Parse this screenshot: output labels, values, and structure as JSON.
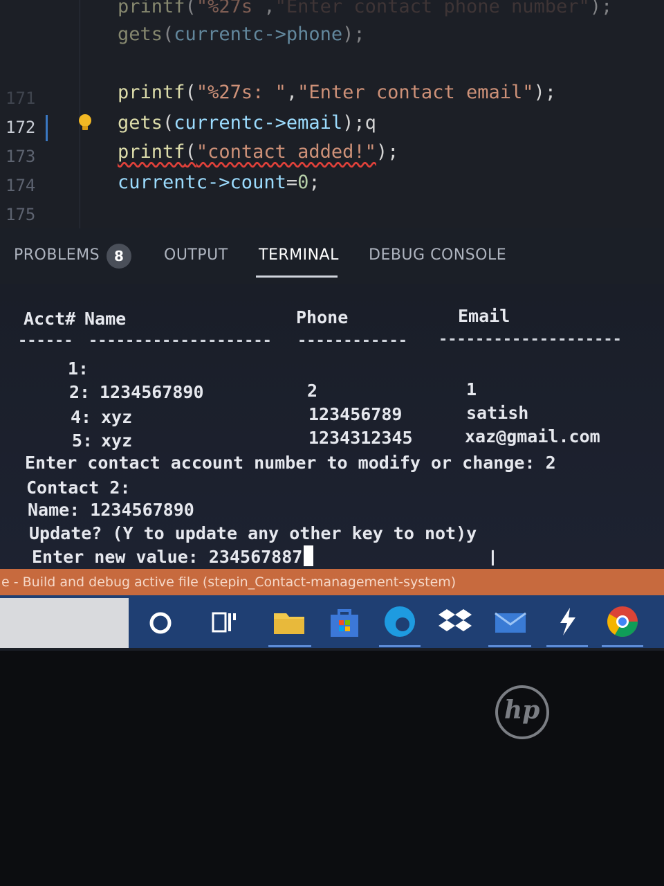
{
  "editor": {
    "line_numbers": [
      "171",
      "172",
      "173",
      "174",
      "175"
    ],
    "lines": [
      {
        "fn": "printf",
        "a": "(",
        "s1": "\"%27s",
        "b": " ,",
        "s2": "\"Enter contact phone number\"",
        "c": ");"
      },
      {
        "fn": "gets",
        "a": "(",
        "v": "currentc->phone",
        "c": ");"
      },
      {
        "fn": "printf",
        "a": "(",
        "s1": "\"%27s: \"",
        "b": ",",
        "s2": "\"Enter contact email\"",
        "c": ");"
      },
      {
        "fn": "gets",
        "a": "(",
        "v": "currentc->email",
        "c": ");q"
      },
      {
        "fn": "printf",
        "a": "(",
        "s1": "\"contact added!\"",
        "c": ");"
      },
      {
        "v": "currentc->count",
        "eq": "=",
        "n": "0",
        "c": ";"
      }
    ]
  },
  "panel": {
    "tabs": [
      "PROBLEMS",
      "OUTPUT",
      "TERMINAL",
      "DEBUG CONSOLE"
    ],
    "problems_count": "8",
    "active_tab": "TERMINAL"
  },
  "terminal": {
    "headers": {
      "acct": "Acct#",
      "name": "Name",
      "phone": "Phone",
      "email": "Email"
    },
    "dashes": {
      "acct": "------",
      "name": "--------------------",
      "phone": "------------",
      "email": "--------------------"
    },
    "rows": [
      {
        "acct": "1:",
        "name": "",
        "phone": "",
        "email": ""
      },
      {
        "acct": "2:",
        "name": "1234567890",
        "phone": "2",
        "email": "1"
      },
      {
        "acct": "4:",
        "name": "xyz",
        "phone": "123456789",
        "email": "satish"
      },
      {
        "acct": "5:",
        "name": "xyz",
        "phone": "1234312345",
        "email": "xaz@gmail.com"
      }
    ],
    "prompt_modify": "Enter contact account number to modify or change: 2",
    "contact_line": "Contact 2:",
    "name_line": "Name: 1234567890",
    "update_line": "Update? (Y to update any other key to not)y",
    "new_value_line": "Enter new value: 234567887"
  },
  "statusbar": {
    "text": "e - Build and debug active file (stepin_Contact-management-system)"
  },
  "taskbar": {
    "icons": [
      "cortana-icon",
      "task-view-icon",
      "file-explorer-icon",
      "store-icon",
      "edge-icon",
      "dropbox-icon",
      "mail-icon",
      "bolt-app-icon",
      "chrome-icon"
    ]
  },
  "bezel": {
    "logo": "hp"
  }
}
